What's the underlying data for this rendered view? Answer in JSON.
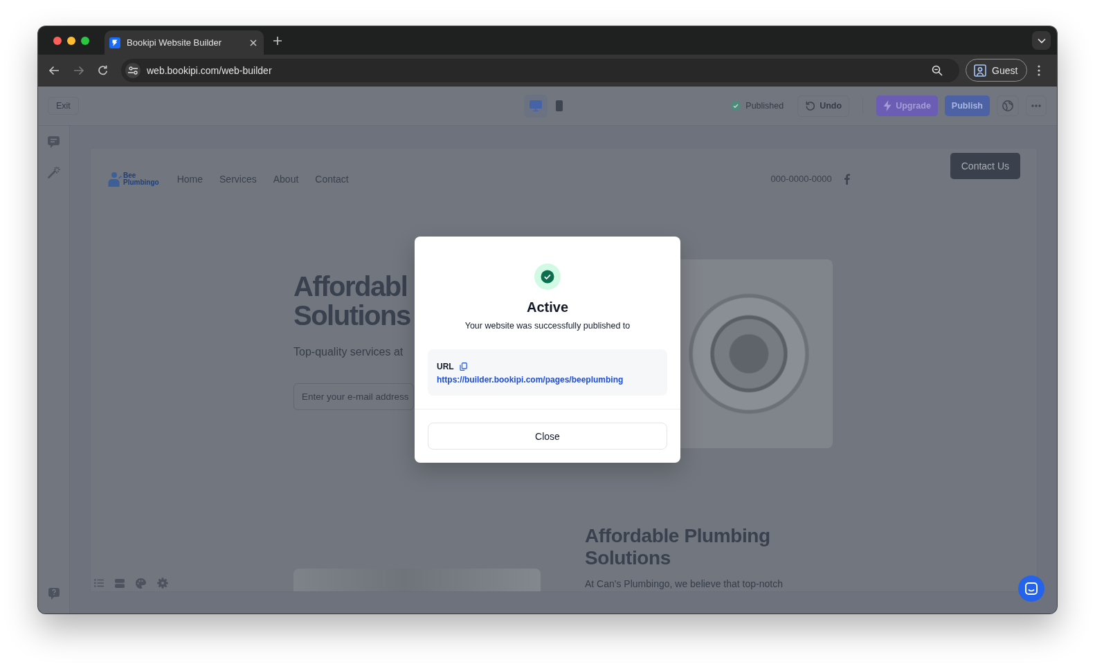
{
  "browser": {
    "tabs": [
      {
        "title": "Bookipi Website Builder",
        "selected": true
      }
    ],
    "forward_disabled": true,
    "address": "web.bookipi.com/web-builder",
    "profile": "Guest"
  },
  "editor_toolbar": {
    "exit": "Exit",
    "devices": [
      {
        "kind": "desktop",
        "selected": true
      },
      {
        "kind": "mobile",
        "selected": false
      }
    ],
    "status": "Published",
    "undo": "Undo",
    "upgrade": "Upgrade",
    "publish": "Publish"
  },
  "website": {
    "logo": [
      "Bee",
      "Plumbingo"
    ],
    "nav": [
      "Home",
      "Services",
      "About",
      "Contact"
    ],
    "phone": "000-0000-0000",
    "contact_button": "Contact Us",
    "hero": {
      "title": [
        "Affordabl",
        "Solutions"
      ],
      "subtitle": "Top-quality services at",
      "email_placeholder": "Enter your e-mail address"
    },
    "section": {
      "title": "Affordable Plumbing Solutions",
      "text": "At Can's Plumbingo, we believe that top-notch"
    }
  },
  "dialog": {
    "title": "Active",
    "message": "Your website was successfully published to",
    "url_label": "URL",
    "url": "https://builder.bookipi.com/pages/beeplumbing",
    "close": "Close"
  }
}
